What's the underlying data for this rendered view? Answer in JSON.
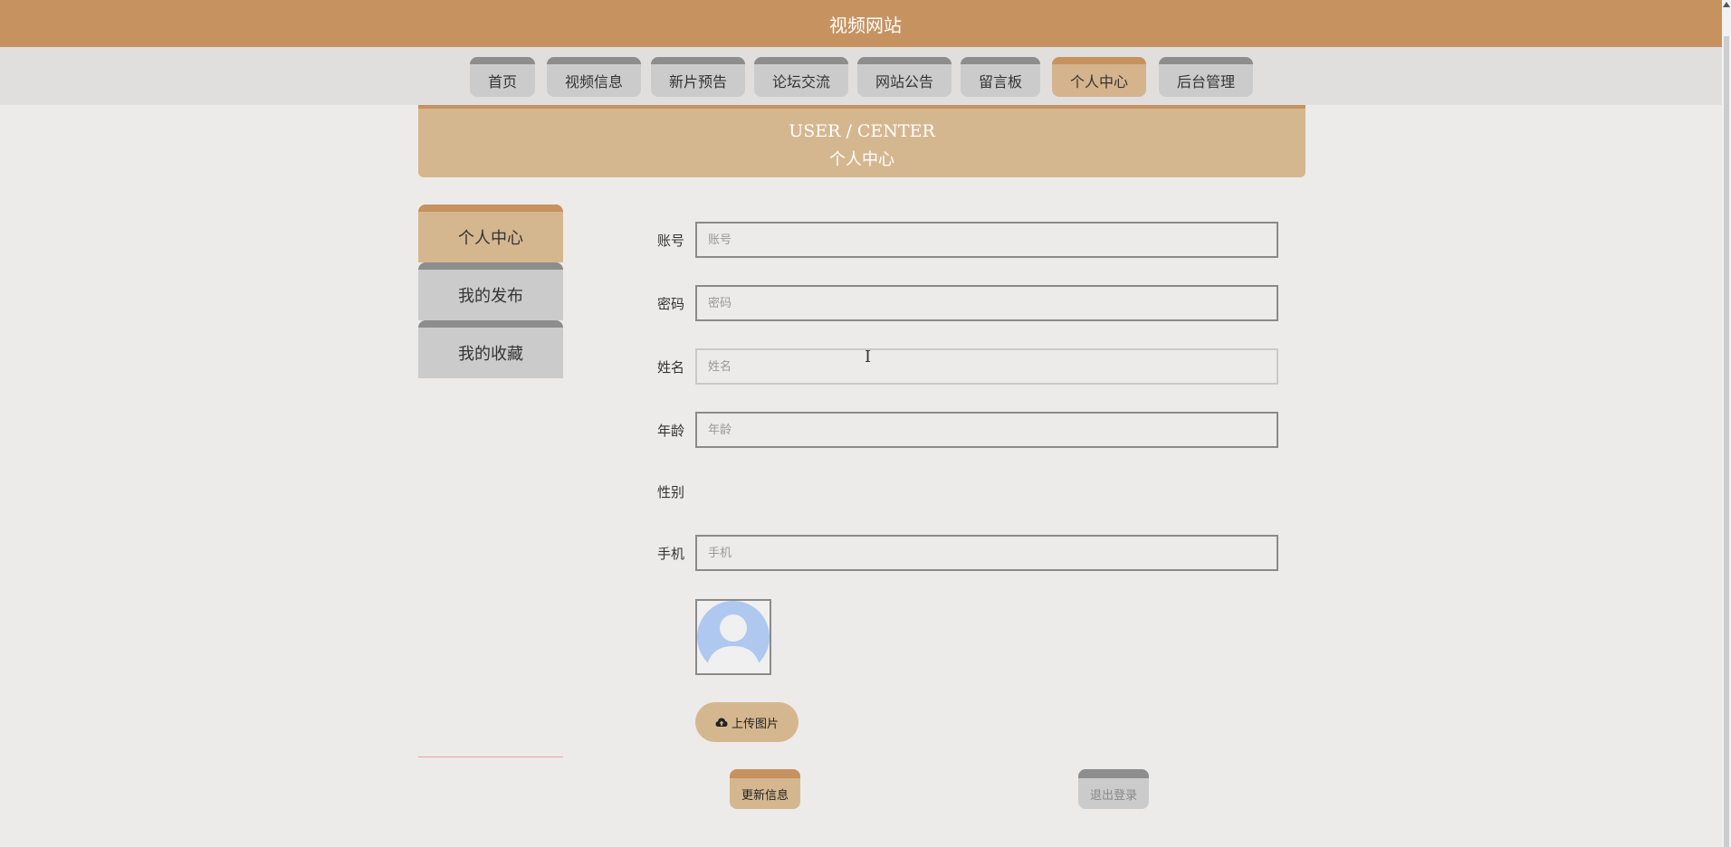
{
  "header": {
    "title": "视频网站"
  },
  "nav": {
    "items": [
      {
        "label": "首页"
      },
      {
        "label": "视频信息"
      },
      {
        "label": "新片预告"
      },
      {
        "label": "论坛交流"
      },
      {
        "label": "网站公告"
      },
      {
        "label": "留言板"
      },
      {
        "label": "个人中心"
      },
      {
        "label": "后台管理"
      }
    ],
    "active": "个人中心"
  },
  "banner": {
    "en": "USER / CENTER",
    "cn": "个人中心"
  },
  "sidebar": {
    "items": [
      {
        "label": "个人中心"
      },
      {
        "label": "我的发布"
      },
      {
        "label": "我的收藏"
      }
    ],
    "active": "个人中心"
  },
  "form": {
    "account": {
      "label": "账号",
      "placeholder": "账号",
      "value": ""
    },
    "password": {
      "label": "密码",
      "placeholder": "密码",
      "value": ""
    },
    "name": {
      "label": "姓名",
      "placeholder": "姓名",
      "value": ""
    },
    "age": {
      "label": "年龄",
      "placeholder": "年龄",
      "value": ""
    },
    "gender": {
      "label": "性别"
    },
    "phone": {
      "label": "手机",
      "placeholder": "手机",
      "value": ""
    },
    "upload_label": "上传图片",
    "update_label": "更新信息",
    "logout_label": "退出登录"
  },
  "colors": {
    "header_bg": "#c6925f",
    "accent": "#d5b78f",
    "inactive_tab": "#cccbcb"
  }
}
